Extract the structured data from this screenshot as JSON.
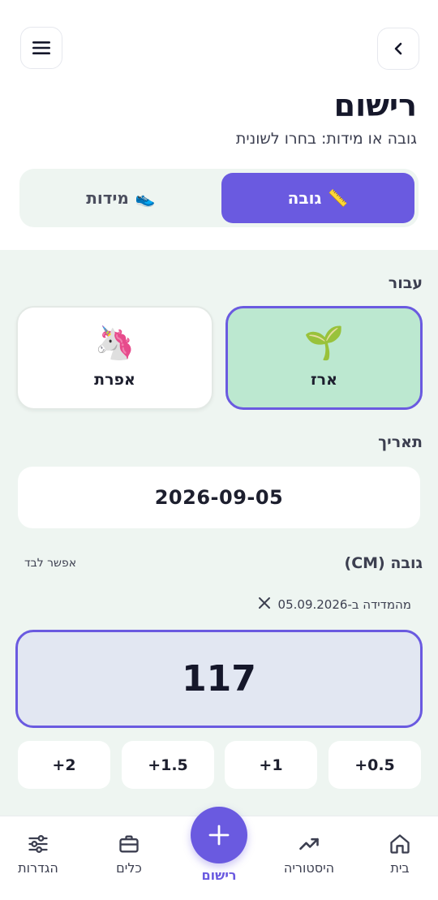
{
  "header": {
    "menu_icon": "hamburger-menu-icon",
    "back_icon": "chevron-left-icon",
    "title": "רישום",
    "subtitle": "גובה או מידות: בחרו לשונית"
  },
  "tabs": [
    {
      "label": "גובה",
      "emoji": "📏",
      "active": true
    },
    {
      "label": "מידות",
      "emoji": "👟",
      "active": false
    }
  ],
  "for_section": {
    "label": "עבור",
    "options": [
      {
        "name": "ארז",
        "emoji": "🌱",
        "selected": true
      },
      {
        "name": "אפרת",
        "emoji": "🦄",
        "selected": false
      }
    ]
  },
  "date_section": {
    "label": "תאריך",
    "value": "2026-09-05"
  },
  "height_section": {
    "label": "גובה (CM)",
    "skip_link": "אפשר לבד",
    "from_note": "מהמדידה ב-05.09.2026",
    "clear_icon": "close-icon",
    "value": "117",
    "increments": [
      "+0.5",
      "+1",
      "+1.5",
      "+2"
    ]
  },
  "bottom_nav": {
    "items": [
      {
        "label": "בית",
        "icon": "home-icon"
      },
      {
        "label": "היסטוריה",
        "icon": "trending-up-icon"
      },
      {
        "label": "רישום",
        "icon": "plus-icon"
      },
      {
        "label": "כלים",
        "icon": "briefcase-icon"
      },
      {
        "label": "הגדרות",
        "icon": "sliders-icon"
      }
    ]
  },
  "colors": {
    "accent": "#6a5ae0",
    "panel_bg": "#eef5f1",
    "selected_card": "#bce8d0",
    "value_box": "#e2e7f2"
  }
}
